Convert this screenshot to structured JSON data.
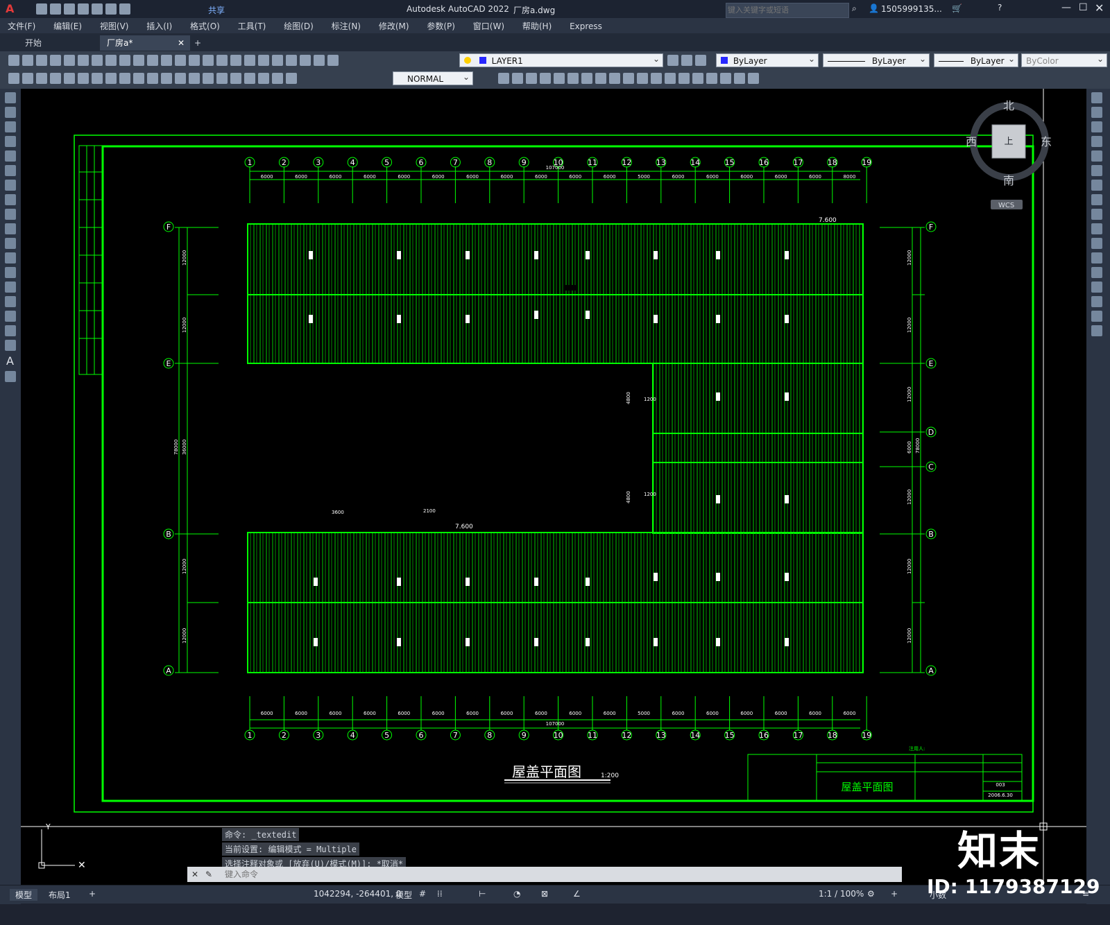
{
  "app": {
    "title": "Autodesk AutoCAD 2022",
    "filename": "厂房a.dwg",
    "share_label": "共享",
    "search_placeholder": "键入关键字或短语",
    "user": "1505999135..."
  },
  "menu": [
    "文件(F)",
    "编辑(E)",
    "视图(V)",
    "插入(I)",
    "格式(O)",
    "工具(T)",
    "绘图(D)",
    "标注(N)",
    "修改(M)",
    "参数(P)",
    "窗口(W)",
    "帮助(H)",
    "Express"
  ],
  "tabs": {
    "start": "开始",
    "doc": "厂房a*",
    "add": "+"
  },
  "toolbar": {
    "layer": "LAYER1",
    "color": "ByLayer",
    "linetype": "ByLayer",
    "lineweight": "ByLayer",
    "plotstyle": "ByColor",
    "textstyle": "NORMAL"
  },
  "viewcube": {
    "north": "北",
    "south": "南",
    "east": "东",
    "west": "西",
    "top": "上",
    "wcs": "WCS"
  },
  "drawing": {
    "grid_x": [
      "1",
      "2",
      "3",
      "4",
      "5",
      "6",
      "7",
      "8",
      "9",
      "10",
      "11",
      "12",
      "13",
      "14",
      "15",
      "16",
      "17",
      "18",
      "19"
    ],
    "bay_spans": [
      "6000",
      "6000",
      "6000",
      "6000",
      "6000",
      "6000",
      "6000",
      "6000",
      "6000",
      "6000",
      "6000",
      "5000",
      "6000",
      "6000",
      "6000",
      "6000",
      "6000",
      "8000"
    ],
    "bottom_spans": [
      "6000",
      "6000",
      "6000",
      "6000",
      "6000",
      "6000",
      "6000",
      "6000",
      "6000",
      "6000",
      "6000",
      "5000",
      "6000",
      "6000",
      "6000",
      "6000",
      "6000",
      "6000"
    ],
    "total_length": "107000",
    "grid_y_left": [
      "F",
      "E",
      "B",
      "A"
    ],
    "grid_y_right": [
      "F",
      "E",
      "D",
      "C",
      "B",
      "A"
    ],
    "left_dims": [
      "12000",
      "12000",
      "36000",
      "78000",
      "12000",
      "12000"
    ],
    "right_dims": [
      "12000",
      "12000",
      "12000",
      "6000",
      "78000",
      "12000",
      "12000",
      "12000"
    ],
    "elevation_1": "7.600",
    "elevation_2": "7.600",
    "dim_4800": "4800",
    "dim_1200": "1200",
    "dim_3600": "3600",
    "dim_2100": "2100",
    "title": "屋盖平面图",
    "scale": "1:200",
    "titleblock_name": "屋盖平面图",
    "titleblock_no": "003",
    "titleblock_date": "2006.6.30",
    "note": "注用人:"
  },
  "command": {
    "lines": [
      "命令: _textedit",
      "当前设置: 编辑模式 = Multiple",
      "选择注释对象或 [放弃(U)/模式(M)]: *取消*"
    ],
    "placeholder": "键入命令"
  },
  "status": {
    "tab_model": "模型",
    "tab_layout": "布局1",
    "coords": "1042294, -264401, 0",
    "mode": "模型",
    "scale": "1:1 / 100%",
    "units": "小数"
  },
  "watermark": {
    "brand": "知末",
    "id": "ID: 1179387129"
  }
}
